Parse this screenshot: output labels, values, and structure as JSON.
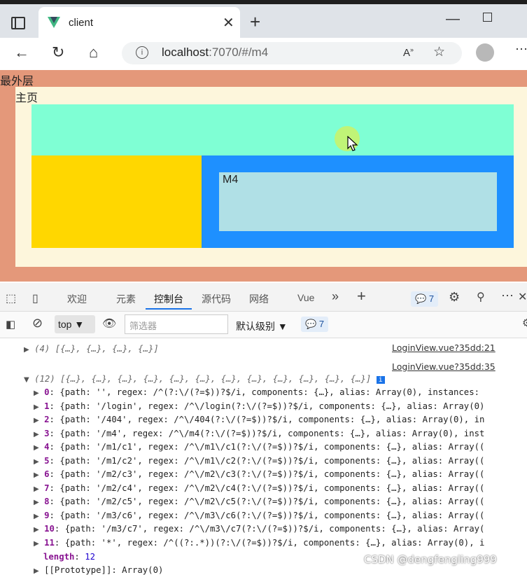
{
  "browser": {
    "tab_title": "client",
    "url_host": "localhost",
    "url_rest": ":7070/#/m4"
  },
  "page": {
    "outer_label": "最外层",
    "home_label": "主页",
    "m4_label": "M4",
    "colors": {
      "outer": "#e4987a",
      "home": "#fdf6dc",
      "header": "#7fffd4",
      "left": "#ffd700",
      "right": "#1e90ff",
      "m4": "#b0e0e6"
    }
  },
  "devtools": {
    "tabs": [
      "欢迎",
      "元素",
      "控制台",
      "源代码",
      "网络",
      "Vue"
    ],
    "active_tab": "控制台",
    "issues_count": "7",
    "context": "top",
    "filter_placeholder": "筛选器",
    "level": "默认级别",
    "level_count": "7"
  },
  "console": {
    "src1": "LoginView.vue?35dd:21",
    "src2": "LoginView.vue?35dd:35",
    "line1": "(4) [{…}, {…}, {…}, {…}]",
    "line2": "(12) [{…}, {…}, {…}, {…}, {…}, {…}, {…}, {…}, {…}, {…}, {…}, {…}]",
    "rows": [
      {
        "k": "0",
        "v": "{path: '', regex: /^(?:\\/(?=$))?$/i, components: {…}, alias: Array(0), instances:"
      },
      {
        "k": "1",
        "v": "{path: '/login', regex: /^\\/login(?:\\/(?=$))?$/i, components: {…}, alias: Array(0)"
      },
      {
        "k": "2",
        "v": "{path: '/404', regex: /^\\/404(?:\\/(?=$))?$/i, components: {…}, alias: Array(0), in"
      },
      {
        "k": "3",
        "v": "{path: '/m4', regex: /^\\/m4(?:\\/(?=$))?$/i, components: {…}, alias: Array(0), inst"
      },
      {
        "k": "4",
        "v": "{path: '/m1/c1', regex: /^\\/m1\\/c1(?:\\/(?=$))?$/i, components: {…}, alias: Array(("
      },
      {
        "k": "5",
        "v": "{path: '/m1/c2', regex: /^\\/m1\\/c2(?:\\/(?=$))?$/i, components: {…}, alias: Array(("
      },
      {
        "k": "6",
        "v": "{path: '/m2/c3', regex: /^\\/m2\\/c3(?:\\/(?=$))?$/i, components: {…}, alias: Array(("
      },
      {
        "k": "7",
        "v": "{path: '/m2/c4', regex: /^\\/m2\\/c4(?:\\/(?=$))?$/i, components: {…}, alias: Array(("
      },
      {
        "k": "8",
        "v": "{path: '/m2/c5', regex: /^\\/m2\\/c5(?:\\/(?=$))?$/i, components: {…}, alias: Array(("
      },
      {
        "k": "9",
        "v": "{path: '/m3/c6', regex: /^\\/m3\\/c6(?:\\/(?=$))?$/i, components: {…}, alias: Array(("
      },
      {
        "k": "10",
        "v": "{path: '/m3/c7', regex: /^\\/m3\\/c7(?:\\/(?=$))?$/i, components: {…}, alias: Array("
      },
      {
        "k": "11",
        "v": "{path: '*', regex: /^((?:.*))(?:\\/(?=$))?$/i, components: {…}, alias: Array(0), i"
      }
    ],
    "length_key": "length",
    "length_val": "12",
    "proto": "[[Prototype]]: Array(0)"
  },
  "watermark": "CSDN @dengfengling999"
}
